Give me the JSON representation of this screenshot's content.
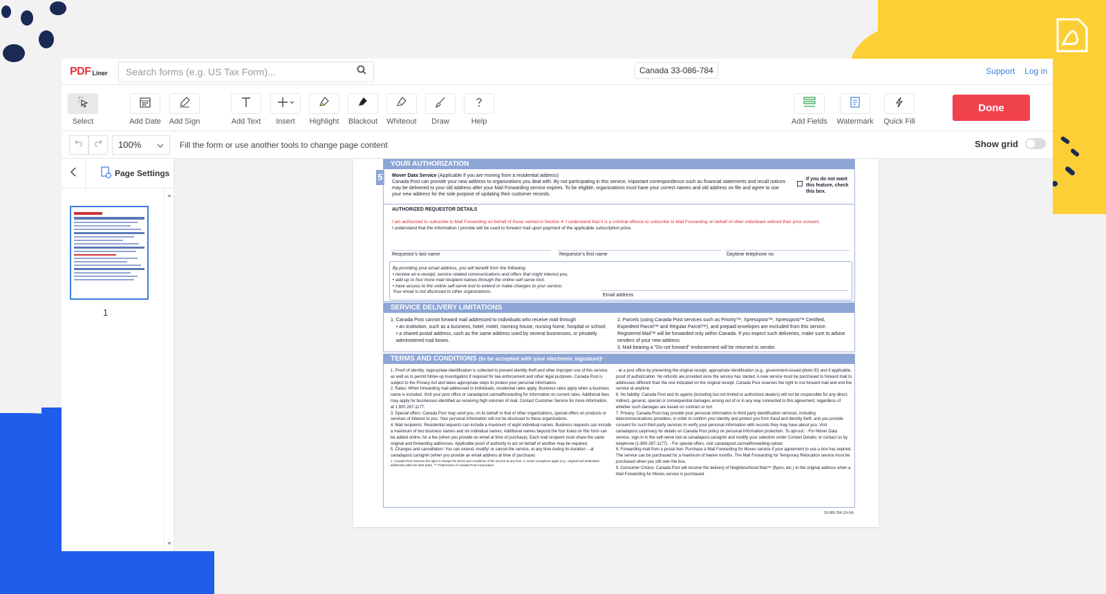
{
  "app": {
    "logo_pdf": "PDF",
    "logo_liner": "Liner",
    "search_placeholder": "Search forms (e.g. US Tax Form)...",
    "document_name": "Canada 33-086-784",
    "support_link": "Support",
    "login_link": "Log in"
  },
  "toolbar": {
    "tools": [
      {
        "label": "Select",
        "icon": "cursor-icon"
      },
      {
        "label": "Add Date",
        "icon": "calendar-icon"
      },
      {
        "label": "Add Sign",
        "icon": "pen-sign-icon"
      },
      {
        "label": "Add Text",
        "icon": "text-icon"
      },
      {
        "label": "Insert",
        "icon": "plus-icon"
      },
      {
        "label": "Highlight",
        "icon": "highlighter-icon"
      },
      {
        "label": "Blackout",
        "icon": "blackout-icon"
      },
      {
        "label": "Whiteout",
        "icon": "eraser-icon"
      },
      {
        "label": "Draw",
        "icon": "brush-icon"
      },
      {
        "label": "Help",
        "icon": "question-icon"
      },
      {
        "label": "Add Fields",
        "icon": "fields-icon"
      },
      {
        "label": "Watermark",
        "icon": "watermark-icon"
      },
      {
        "label": "Quick Fill",
        "icon": "lightning-icon"
      }
    ],
    "done_label": "Done"
  },
  "subbar": {
    "zoom": "100%",
    "hint": "Fill the form or use another tools to change page content",
    "show_grid_label": "Show grid",
    "show_grid": false
  },
  "sidebar": {
    "page_settings_label": "Page Settings",
    "page_number": "1"
  },
  "document": {
    "section_number": "5",
    "your_authorization": {
      "title": "YOUR AUTHORIZATION",
      "mover_title": "Mover Data Service",
      "mover_sub": "(Applicable if you are moving from a residential address)",
      "mover_text": "Canada Post can provide your new address to organizations you deal with. By not participating in this service, important correspondence such as financial statements and recall notices may be delivered to your old address after your Mail Forwarding service expires. To be eligible, organizations must have your correct names and old address on file and agree to use your new address for the sole purpose of updating their customer records.",
      "optout": "If you do not want this feature, check this box."
    },
    "requestor": {
      "title": "AUTHORIZED REQUESTOR DETAILS",
      "red_text": "I am authorized to subscribe to Mail Forwarding on behalf of those named in Section 4. I understand that it is a criminal offence to subscribe to Mail Forwarding on behalf of other individuals without their prior consent.",
      "text2": "I understand that the information I provide will be used to forward mail upon payment of the applicable subscription price.",
      "last_name": "Requestor's last name",
      "first_name": "Requestor's first name",
      "phone": "Daytime telephone no.",
      "email_intro": "By providing your email address, you will benefit from the following:",
      "email_b1": "• receive an e-receipt, service related communications and offers that might interest you,",
      "email_b2": "• add up to four more mail recipient names through the online self-serve tool,",
      "email_b3": "• have access to the online self-serve tool to extend or make changes to your service.",
      "email_note": "Your email is not disclosed to other organizations.",
      "email_label": "Email address"
    },
    "delivery": {
      "title": "SERVICE DELIVERY LIMITATIONS",
      "l1": "1. Canada Post cannot forward mail addressed to individuals who receive mail through",
      "l2": "• an institution, such as a business, hotel, motel, rooming house, nursing home, hospital or school;",
      "l3": "• a shared postal address, such as the same address used by several businesses, or privately administered mail boxes.",
      "r1": "2. Parcels (using Canada Post services such as Priority™, Xpresspost™, Xpresspost™ Certified, Expedited Parcel™ and Regular Parcel™), and prepaid envelopes are excluded from this service. Registered Mail™ will be forwarded only within Canada. If you expect such deliveries, make sure to advise senders of your new address.",
      "r2": "3. Mail bearing a \"Do not forward\" endorsement will be returned to sender."
    },
    "terms": {
      "title": "TERMS AND CONDITIONS",
      "title_sub": "(to be accepted with your electronic signature)¹",
      "left": [
        "1. Proof of identity: Appropriate identification is collected to prevent identity theft and other improper use of this service, as well as to permit follow-up investigation if required for law enforcement and other legal purposes. Canada Post is subject to the Privacy Act and takes appropriate steps to protect your personal information.",
        "2. Rates: When forwarding mail addressed to individuals, residential rates apply. Business rates apply when a business name is included. Visit your post office or canadapost.ca/mailforwarding for information on current rates. Additional fees may apply for businesses identified as receiving high volumes of mail. Contact Customer Service for more information, at 1 800 267-1177.",
        "3. Special offers: Canada Post may send you, on its behalf or that of other organizations, special offers on products or services of interest to you. Your personal information will not be disclosed to these organizations.",
        "4. Mail recipients: Residential requests can include a maximum of eight individual names. Business requests can include a maximum of two business names and six individual names. Additional names beyond the four listed on this form can be added online, for a fee (when you provide an email at time of purchase). Each mail recipient must share the same original and forwarding addresses. Applicable proof of authority to act on behalf of another may be required.",
        "5. Changes and cancellation: You can extend, modify² or cancel the service, at any time during its duration: - at canadapost.ca/signin (when you provide an email address at time of purchase)",
        "1. Canada Post reserves the right to change the terms and conditions of the service at any time. 2. Some exceptions apply (e.g., original and destination addresses after the start date). ™ Trademarks of Canada Post Corporation."
      ],
      "right": [
        "- at a post office by presenting the original receipt, appropriate identification (e.g., government-issued photo ID) and if applicable, proof of authorization. No refunds are provided once the service has started. A new service must be purchased to forward mail to addresses different than the one indicated on the original receipt. Canada Post reserves the right to not forward mail and end the service at anytime.",
        "6. No liability: Canada Post and its agents (including but not limited to authorized dealers) will not be responsible for any direct, indirect, general, special or consequential damages arising out of or in any way connected to this agreement, regardless of whether such damages are based on contract or tort.",
        "7. Privacy: Canada Post may provide your personal information to third party identification services, including telecommunications providers, in order to confirm your identity and protect you from fraud and identity theft, and you provide consent for such third party services to verify your personal information with records they may have about you. Visit canadapost.ca/privacy for details on Canada Post policy on personal information protection. To opt-out: - For Mover Data service, sign-in to the self-serve tool at canadapost.ca/signin and modify your selection under Contact Details; or contact us by telephone (1-800-267-1177). - For special offers, visit canadapost.ca/mailforwarding-optout.",
        "8. Forwarding mail from a postal box: Purchase a Mail Forwarding for Moves service if your agreement to use a box has expired. The service can be purchased for a maximum of twelve months. The Mail Forwarding for Temporary Relocation service must be purchased when you still own the box.",
        "9. Consumer Choice: Canada Post will resume the delivery of Neighbourhood Mail™ (flyers, etc.) to the original address when a Mail Forwarding for Moves service is purchased."
      ]
    },
    "form_code": "33-086-784 (19-04)"
  },
  "colors": {
    "accent": "#f0424d",
    "link": "#3b7ddd",
    "section_header": "#8ea6d6",
    "deco_yellow": "#fccf36",
    "deco_blue": "#1e5eea"
  }
}
